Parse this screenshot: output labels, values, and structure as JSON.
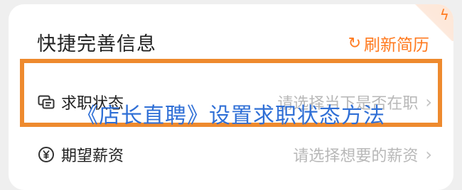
{
  "card": {
    "title": "快捷完善信息",
    "refresh_label": "刷新简历",
    "refresh_icon": "refresh-icon",
    "corner_icon": "lightning-icon",
    "accent_color": "#ff7a1f"
  },
  "rows": [
    {
      "label": "求职状态",
      "value": "请选择当下是否在职",
      "icon": "id-card-icon"
    },
    {
      "label": "期望薪资",
      "value": "请选择想要的薪资",
      "icon": "yuan-icon"
    }
  ],
  "overlay": {
    "caption": "《店长直聘》设置求职状态方法"
  },
  "highlight_color": "#ee8a2e"
}
